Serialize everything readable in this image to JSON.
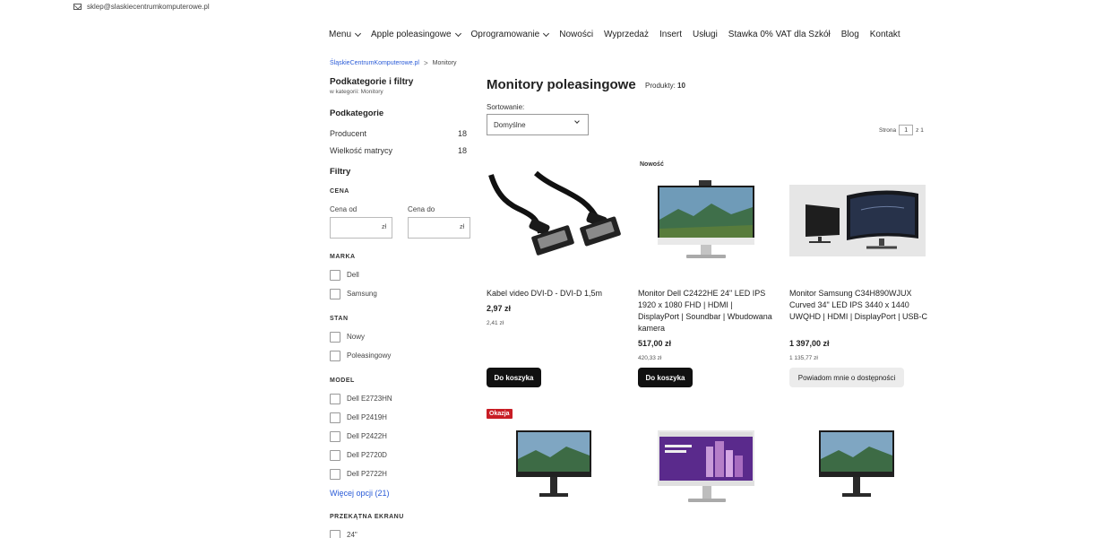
{
  "header": {
    "email": "sklep@slaskiecentrumkomputerowe.pl"
  },
  "nav": [
    {
      "label": "Menu",
      "dropdown": true
    },
    {
      "label": "Apple poleasingowe",
      "dropdown": true
    },
    {
      "label": "Oprogramowanie",
      "dropdown": true
    },
    {
      "label": "Nowości",
      "dropdown": false
    },
    {
      "label": "Wyprzedaż",
      "dropdown": false
    },
    {
      "label": "Insert",
      "dropdown": false
    },
    {
      "label": "Usługi",
      "dropdown": false
    },
    {
      "label": "Stawka 0% VAT dla Szkół",
      "dropdown": false
    },
    {
      "label": "Blog",
      "dropdown": false
    },
    {
      "label": "Kontakt",
      "dropdown": false
    }
  ],
  "breadcrumb": {
    "home": "ŚląskieCentrumKomputerowe.pl",
    "separator": ">",
    "current": "Monitory"
  },
  "sidebar": {
    "title": "Podkategorie i filtry",
    "subtitle": "w kategorii: Monitory",
    "subcategories_heading": "Podkategorie",
    "subcategories": [
      {
        "label": "Producent",
        "count": "18"
      },
      {
        "label": "Wielkość matrycy",
        "count": "18"
      }
    ],
    "filters_heading": "Filtry",
    "price": {
      "heading": "CENA",
      "from_label": "Cena od",
      "to_label": "Cena do",
      "unit": "zł"
    },
    "brand": {
      "heading": "MARKA",
      "options": [
        "Dell",
        "Samsung"
      ]
    },
    "condition": {
      "heading": "STAN",
      "options": [
        "Nowy",
        "Poleasingowy"
      ]
    },
    "model": {
      "heading": "MODEL",
      "options": [
        "Dell E2723HN",
        "Dell P2419H",
        "Dell P2422H",
        "Dell P2720D",
        "Dell P2722H"
      ],
      "more": "Więcej opcji (21)"
    },
    "diagonal": {
      "heading": "PRZEKĄTNA EKRANU",
      "options": [
        "24\""
      ]
    }
  },
  "main": {
    "title": "Monitory poleasingowe",
    "count_label": "Produkty:",
    "count": "10",
    "sort_label": "Sortowanie:",
    "sort_value": "Domyślne",
    "pager": {
      "label": "Strona",
      "page": "1",
      "of": "z 1"
    }
  },
  "products": [
    {
      "name": "Kabel video DVI-D - DVI-D 1,5m",
      "price": "2,97 zł",
      "net": "2,41 zł",
      "button": "Do koszyka",
      "badge": ""
    },
    {
      "name": "Monitor Dell C2422HE 24\" LED IPS 1920 x 1080 FHD | HDMI | DisplayPort | Soundbar | Wbudowana kamera",
      "price": "517,00 zł",
      "net": "420,33 zł",
      "button": "Do koszyka",
      "badge": "Nowość"
    },
    {
      "name": "Monitor Samsung C34H890WJUX Curved 34\" LED IPS 3440 x 1440 UWQHD | HDMI | DisplayPort | USB-C",
      "price": "1 397,00 zł",
      "net": "1 135,77 zł",
      "button": "Powiadom mnie o dostępności",
      "badge": ""
    }
  ],
  "row2": {
    "sale_badge": "Okazja"
  },
  "colors": {
    "link": "#2a5bd7",
    "button_dark": "#111111",
    "sale": "#c81d25"
  }
}
